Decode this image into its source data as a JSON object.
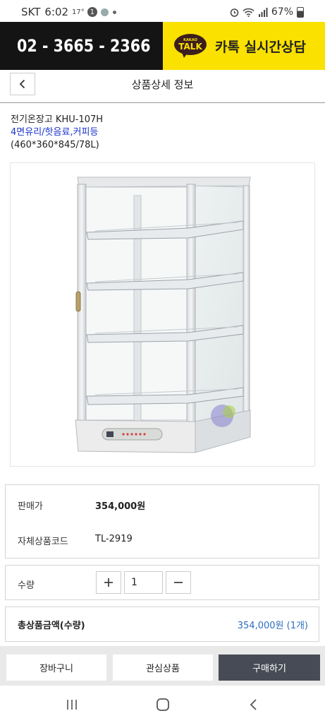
{
  "status_bar": {
    "carrier": "SKT",
    "time": "6:02",
    "temp": "17°",
    "badge": "1",
    "battery": "67%"
  },
  "banner": {
    "phone_number": "02 - 3665 - 2366",
    "kakao_small": "KAKAO",
    "kakao_talk": "TALK",
    "kakao_label": "카톡 실시간상담"
  },
  "header": {
    "title": "상품상세 정보"
  },
  "product": {
    "name": "전기온장고 KHU-107H",
    "description": "4면유리/핫음료,커피등",
    "size": "(460*360*845/78L)"
  },
  "details": {
    "price_label": "판매가",
    "price_value": "354,000원",
    "code_label": "자체상품코드",
    "code_value": "TL-2919"
  },
  "quantity": {
    "label": "수량",
    "value": "1"
  },
  "total": {
    "label": "총상품금액(수량)",
    "value": "354,000원 (1개)"
  },
  "actions": {
    "cart": "장바구니",
    "wishlist": "관심상품",
    "buy": "구매하기"
  },
  "colors": {
    "kakao_yellow": "#fae100",
    "banner_dark": "#141414",
    "desc_blue": "#1a33cc",
    "total_blue": "#2f6fbe",
    "buy_button": "#474b55"
  },
  "nav": {
    "icons": [
      "recent-apps-icon",
      "home-icon",
      "back-icon"
    ]
  }
}
